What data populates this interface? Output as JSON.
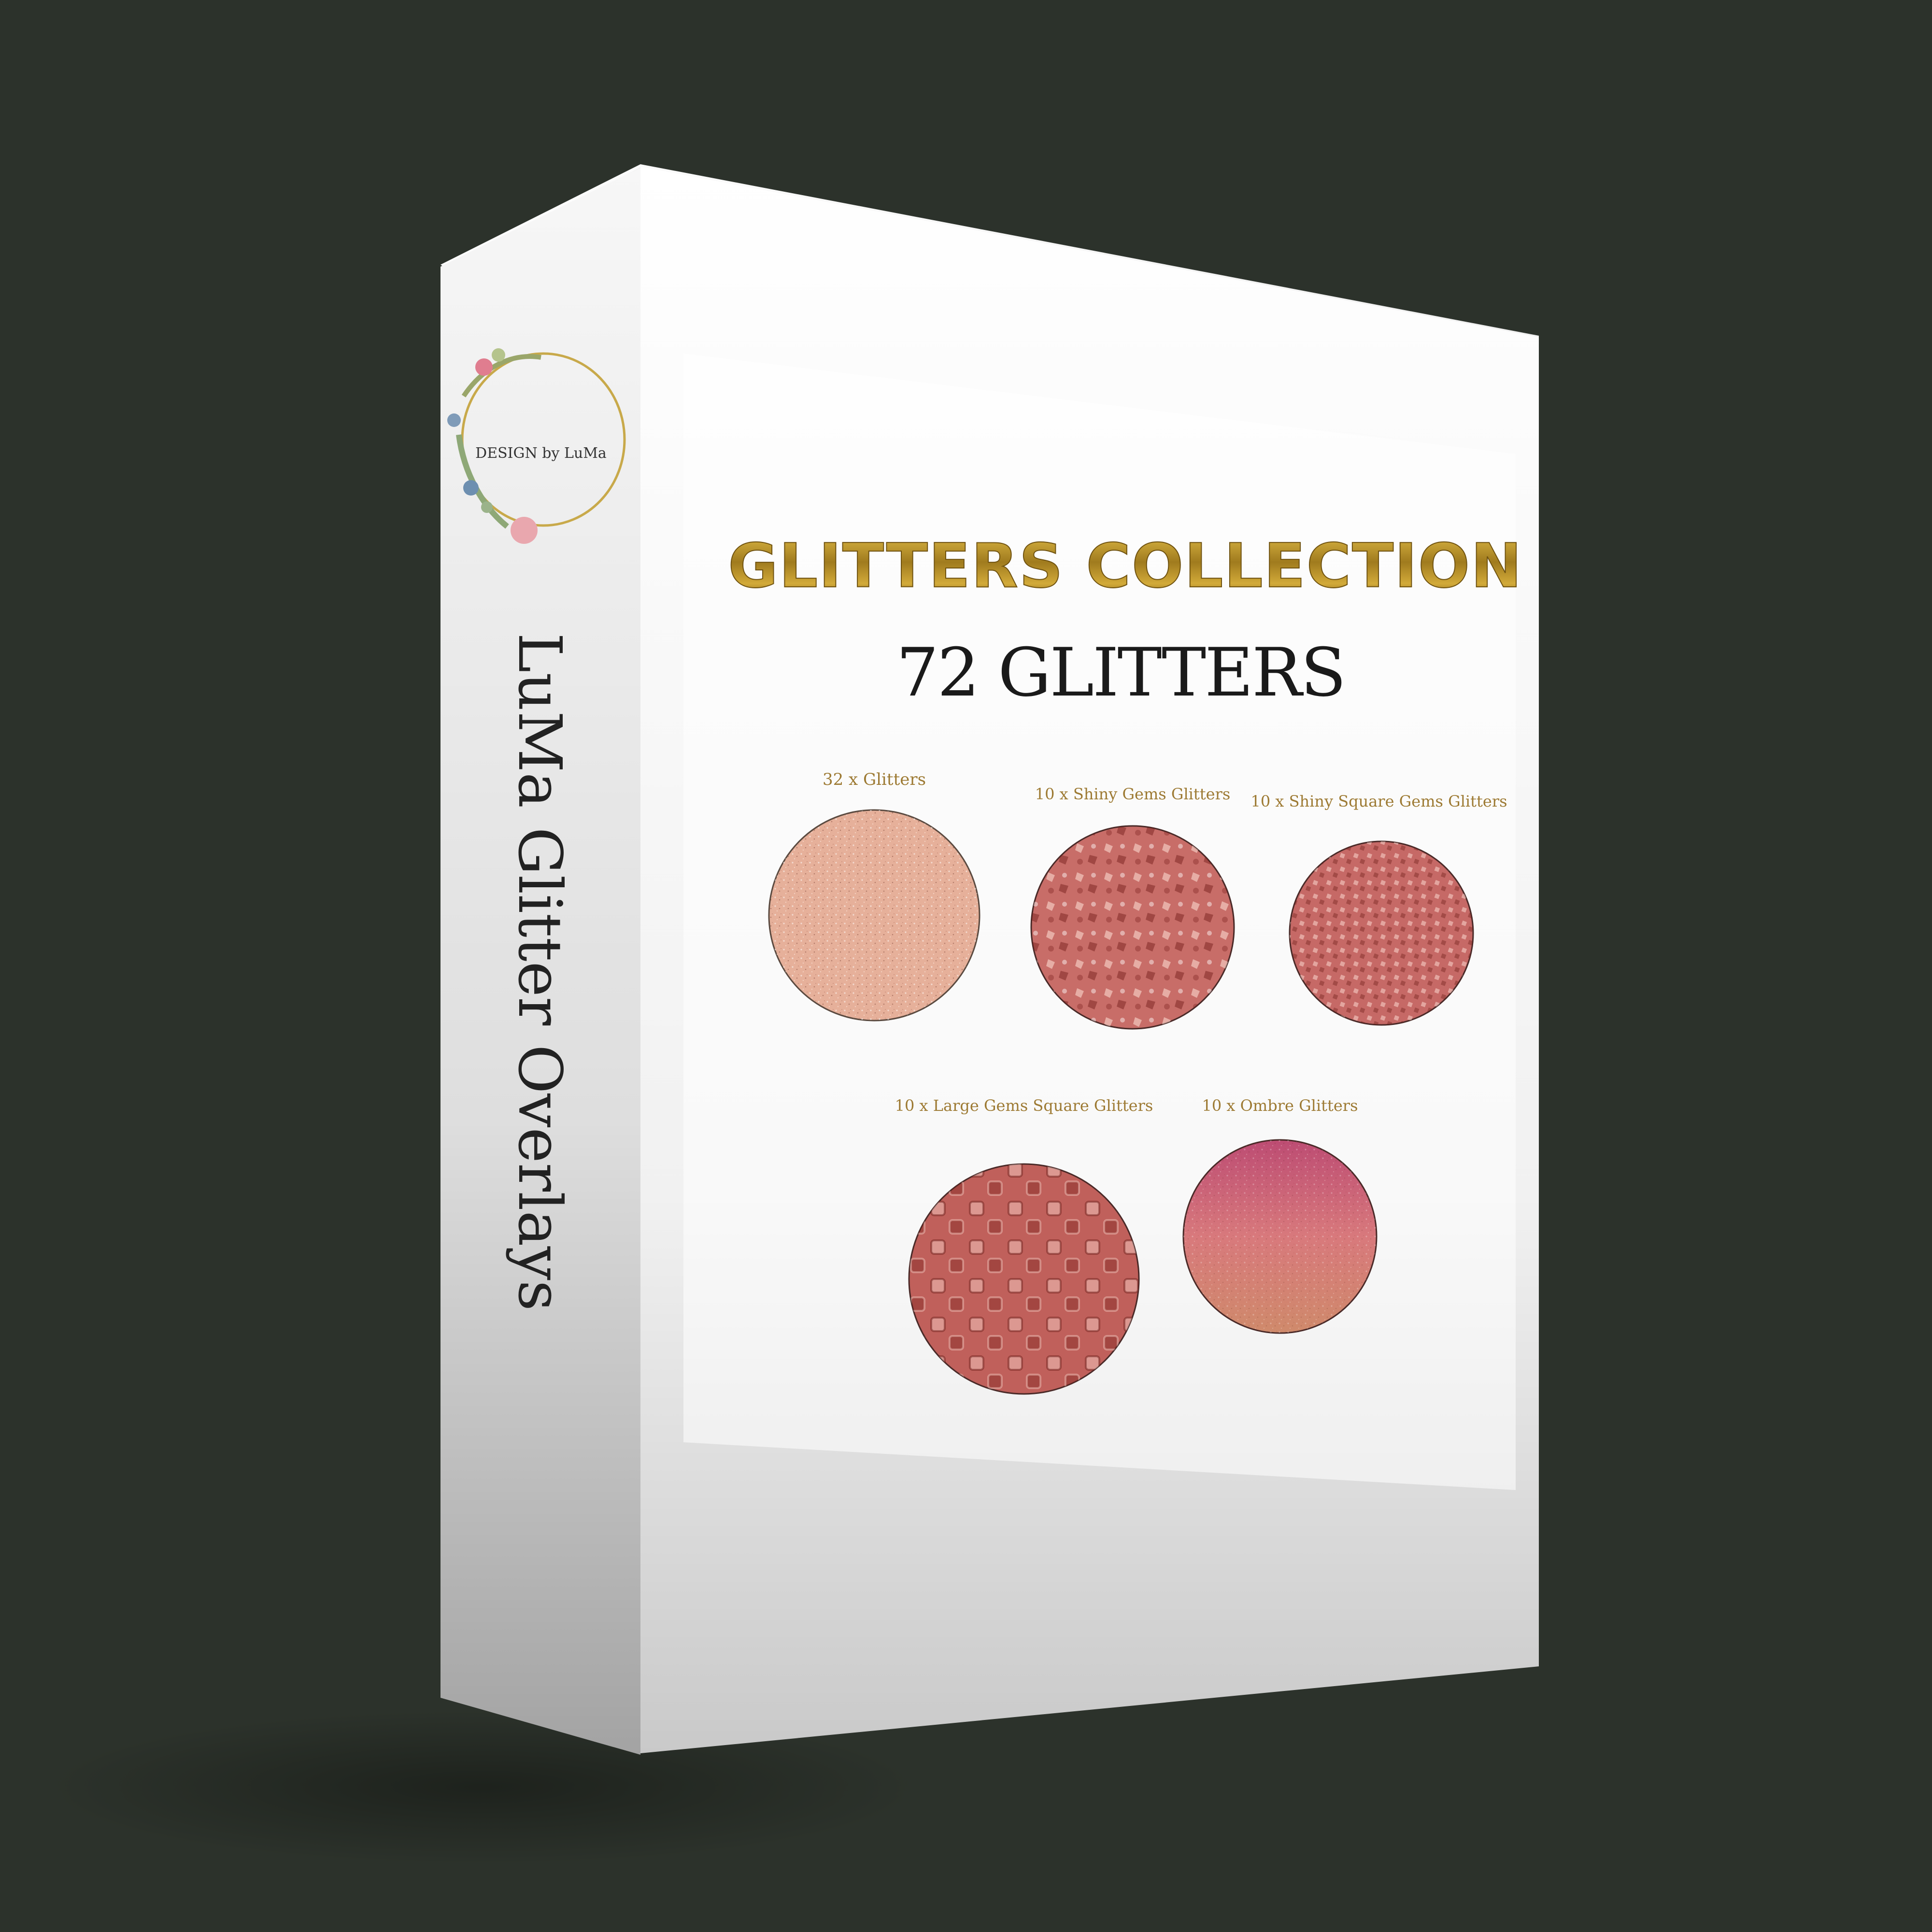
{
  "box": {
    "spine_title": "LuMa Glitter Overlays",
    "logo_text": "DESIGN by LuMa",
    "headline": "GLITTERS COLLECTION",
    "subheadline": "72 GLITTERS",
    "swatches": [
      {
        "label": "32 x Glitters",
        "colors": [
          "#e6b09a",
          "#c4735e",
          "#f2cdb9"
        ]
      },
      {
        "label": "10 x Shiny Gems Glitters",
        "colors": [
          "#c86d68",
          "#8e3431",
          "#f2b0a6"
        ]
      },
      {
        "label": "10 x Shiny Square Gems Glitters",
        "colors": [
          "#c66966",
          "#8a302d",
          "#f0aaa1"
        ]
      },
      {
        "label": "10 x Large Gems Square Glitters",
        "colors": [
          "#c0605b",
          "#86302b",
          "#eba49a"
        ]
      },
      {
        "label": "10 x Ombre Glitters",
        "colors": [
          "#bd4c73",
          "#d8797c",
          "#cf8a6b"
        ]
      }
    ]
  },
  "colors": {
    "background": "#2c322b",
    "gold": "#b38b26",
    "label_gold": "#9d7a33",
    "spine_text": "#222222"
  }
}
